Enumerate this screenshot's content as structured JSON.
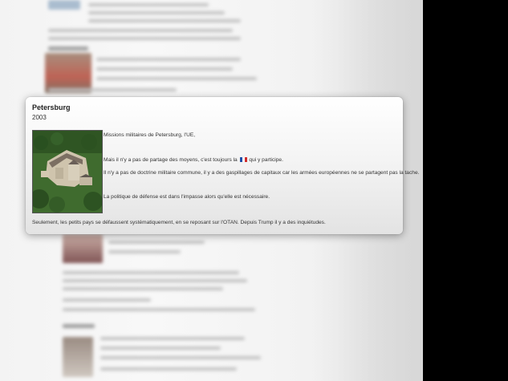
{
  "popup": {
    "title": "Petersburg",
    "year": "2003",
    "photo_icon": "castle-aerial-photo",
    "line1": "Missions militaires  de Petersburg, l'UE,",
    "line2a": "Mais il n'y a pas de partage des moyens, c'est toujours la",
    "line2b": "qui y participe.",
    "line3": "Il n'y a pas de doctrine militaire commune, il y a des gaspillages de capitaux car les armées européennes ne se partagent pas la tache.",
    "line4": "La politique de défense est dans l'impasse alors qu'elle est nécessaire.",
    "line5": "Seulement, les petits pays se défaussent systématiquement, en se reposant sur l'OTAN. Depuis Trump il y a des inquiétudes.",
    "flag_icon": "french-flag-icon",
    "flag_colors": [
      "#1f4fa8",
      "#ffffff",
      "#d02b2b"
    ]
  },
  "colors": {
    "side_panel": "#000000",
    "page_background": "#f5f5f5"
  }
}
